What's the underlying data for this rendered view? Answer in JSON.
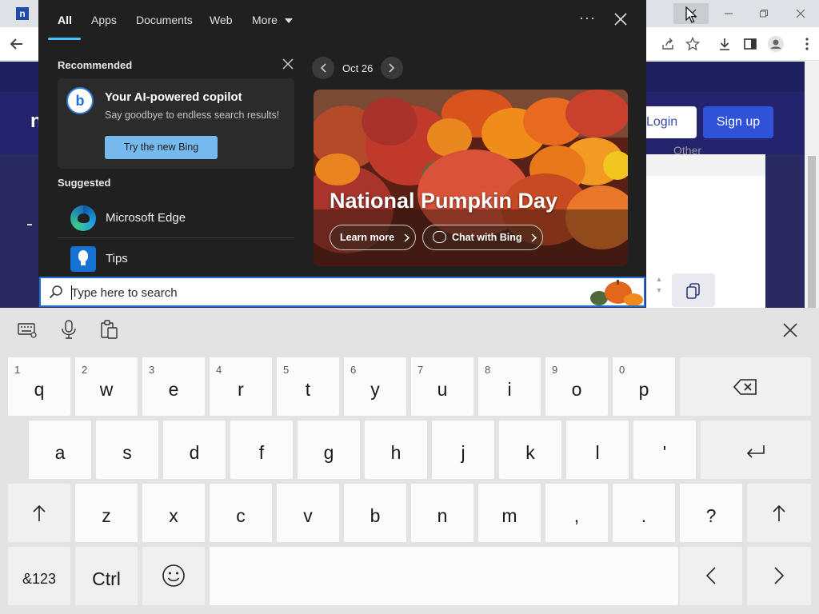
{
  "browser": {
    "favicon_letter": "n",
    "login_label": "Login",
    "signup_label": "Sign up",
    "panel_text": "Other",
    "logo_fragment": "n"
  },
  "flyout": {
    "tabs": [
      "All",
      "Apps",
      "Documents",
      "Web",
      "More"
    ],
    "more_options": "···",
    "recommended_heading": "Recommended",
    "copilot": {
      "title": "Your AI-powered copilot",
      "subtitle": "Say goodbye to endless search results!",
      "button": "Try the new Bing"
    },
    "suggested_heading": "Suggested",
    "suggested": [
      {
        "label": "Microsoft Edge",
        "icon": "edge-icon"
      },
      {
        "label": "Tips",
        "icon": "tips-icon"
      }
    ],
    "date": "Oct 26",
    "hero": {
      "title": "National Pumpkin Day",
      "learn_more": "Learn more",
      "chat_bing": "Chat with Bing"
    }
  },
  "search": {
    "placeholder": "Type here to search"
  },
  "keyboard": {
    "row1": [
      {
        "k": "q",
        "alt": "1"
      },
      {
        "k": "w",
        "alt": "2"
      },
      {
        "k": "e",
        "alt": "3"
      },
      {
        "k": "r",
        "alt": "4"
      },
      {
        "k": "t",
        "alt": "5"
      },
      {
        "k": "y",
        "alt": "6"
      },
      {
        "k": "u",
        "alt": "7"
      },
      {
        "k": "i",
        "alt": "8"
      },
      {
        "k": "o",
        "alt": "9"
      },
      {
        "k": "p",
        "alt": "0"
      }
    ],
    "row2": [
      "a",
      "s",
      "d",
      "f",
      "g",
      "h",
      "j",
      "k",
      "l",
      "'"
    ],
    "row3": [
      "z",
      "x",
      "c",
      "v",
      "b",
      "n",
      "m",
      ",",
      ".",
      "?"
    ],
    "symbols_label": "&123",
    "ctrl_label": "Ctrl",
    "colors": {
      "key": "#fbfbfb",
      "background": "#e3e3e3",
      "accent": "#1f6fd6"
    }
  }
}
